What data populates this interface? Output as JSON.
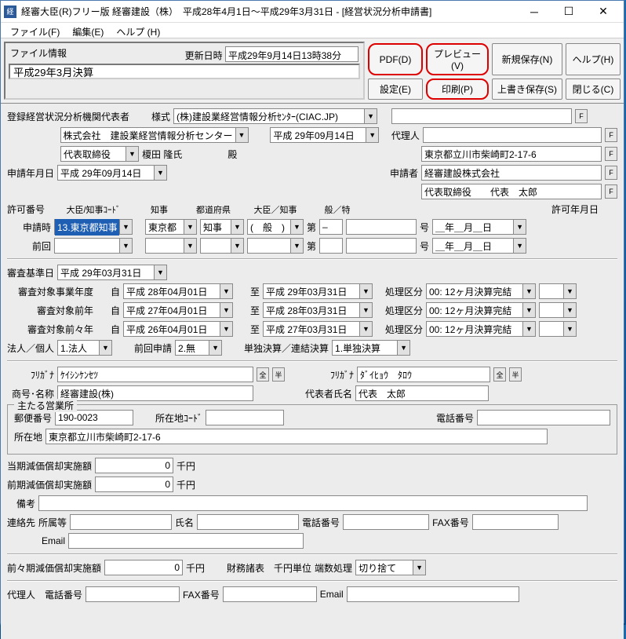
{
  "window": {
    "title": "経審大臣(R)フリー版 経審建設（株）　平成28年4月1日～平成29年3月31日 - [経営状況分析申請書]"
  },
  "menu": {
    "file": "ファイル(F)",
    "edit": "編集(E)",
    "help": "ヘルプ (H)"
  },
  "fileinfo": {
    "label": "ファイル情報",
    "update_label": "更新日時",
    "update_value": "平成29年9月14日13時38分",
    "filename": "平成29年3月決算"
  },
  "buttons": {
    "pdf": "PDF(D)",
    "preview": "プレビュー(V)",
    "new_save": "新規保存(N)",
    "help": "ヘルプ(H)",
    "settings": "設定(E)",
    "print": "印刷(P)",
    "overwrite": "上書き保存(S)",
    "close": "閉じる(C)"
  },
  "form": {
    "reg_org_label": "登録経営状況分析機関代表者",
    "style_label": "様式",
    "style_value": "(株)建設業経営情報分析ｾﾝﾀｰ(CIAC.JP)",
    "company_name": "株式会社　建設業経営情報分析センター",
    "date1": "平成 29年09月14日",
    "agent_label": "代理人",
    "rep_role": "代表取締役",
    "rep_name": "榎田 隆氏",
    "dono": "殿",
    "address_r1": "東京都立川市柴崎町2-17-6",
    "address_r2": "経審建設株式会社",
    "applicant_label": "申請者",
    "applicant_value": "代表取締役　　代表　太郎",
    "apply_date_label": "申請年月日",
    "apply_date_value": "平成 29年09月14日",
    "permit_no_label": "許可番号",
    "hdr_minister_code": "大臣/知事ｺｰﾄﾞ",
    "hdr_governor": "知事",
    "hdr_pref": "都道府県",
    "hdr_minister": "大臣／知事",
    "hdr_general": "般／特",
    "permit_date_label": "許可年月日",
    "apply_time_label": "申請時",
    "apply_time_value": "13.東京都知事",
    "tokyo": "東京都",
    "chiji": "知事",
    "general": "(　般　)",
    "dai": "第",
    "gou": "号",
    "year_month_day": "＿年＿月＿日",
    "prev_label": "前回",
    "review_date_label": "審査基準日",
    "review_date_value": "平成 29年03月31日",
    "target_year_label": "審査対象事業年度",
    "target_prev_label": "審査対象前年",
    "target_prev2_label": "審査対象前々年",
    "from_label": "自",
    "to_label": "至",
    "proc_label": "処理区分",
    "proc_value": "00: 12ヶ月決算完結",
    "ty_from": "平成 28年04月01日",
    "ty_to": "平成 29年03月31日",
    "py_from": "平成 27年04月01日",
    "py_to": "平成 28年03月31日",
    "ppy_from": "平成 26年04月01日",
    "ppy_to": "平成 27年03月31日",
    "hojin_label": "法人／個人",
    "hojin_value": "1.法人",
    "prev_apply_label": "前回申請",
    "prev_apply_value": "2.無",
    "kessan_type_label": "単独決算／連結決算",
    "kessan_type_value": "1.単独決算",
    "furigana_label": "ﾌﾘｶﾞﾅ",
    "furigana_value": "ｹｲｼﾝｹﾝｾﾂ",
    "zen": "全",
    "han": "半",
    "rep_furigana": "ﾀﾞｲﾋｮｳ　ﾀﾛｳ",
    "trade_name_label": "商号･名称",
    "trade_name_value": "経審建設(株)",
    "rep_name_label": "代表者氏名",
    "rep_name_value": "代表　太郎",
    "main_office_label": "主たる営業所",
    "postal_label": "郵便番号",
    "postal_value": "190-0023",
    "loc_code_label": "所在地ｺｰﾄﾞ",
    "phone_label": "電話番号",
    "loc_label": "所在地",
    "loc_value": "東京都立川市柴崎町2-17-6",
    "cur_dep_label": "当期減価償却実施額",
    "prev_dep_label": "前期減価償却実施額",
    "zero": "0",
    "senyen": "千円",
    "biko_label": "備考",
    "contact_label": "連絡先",
    "dept_label": "所属等",
    "name_label": "氏名",
    "fax_label": "FAX番号",
    "email_label": "Email",
    "prev2_dep_label": "前々期減価償却実施額",
    "fin_label": "財務諸表　千円単位",
    "rounding_label": "端数処理",
    "rounding_value": "切り捨て",
    "agent_phone_label": "代理人　電話番号",
    "f_btn": "F"
  }
}
